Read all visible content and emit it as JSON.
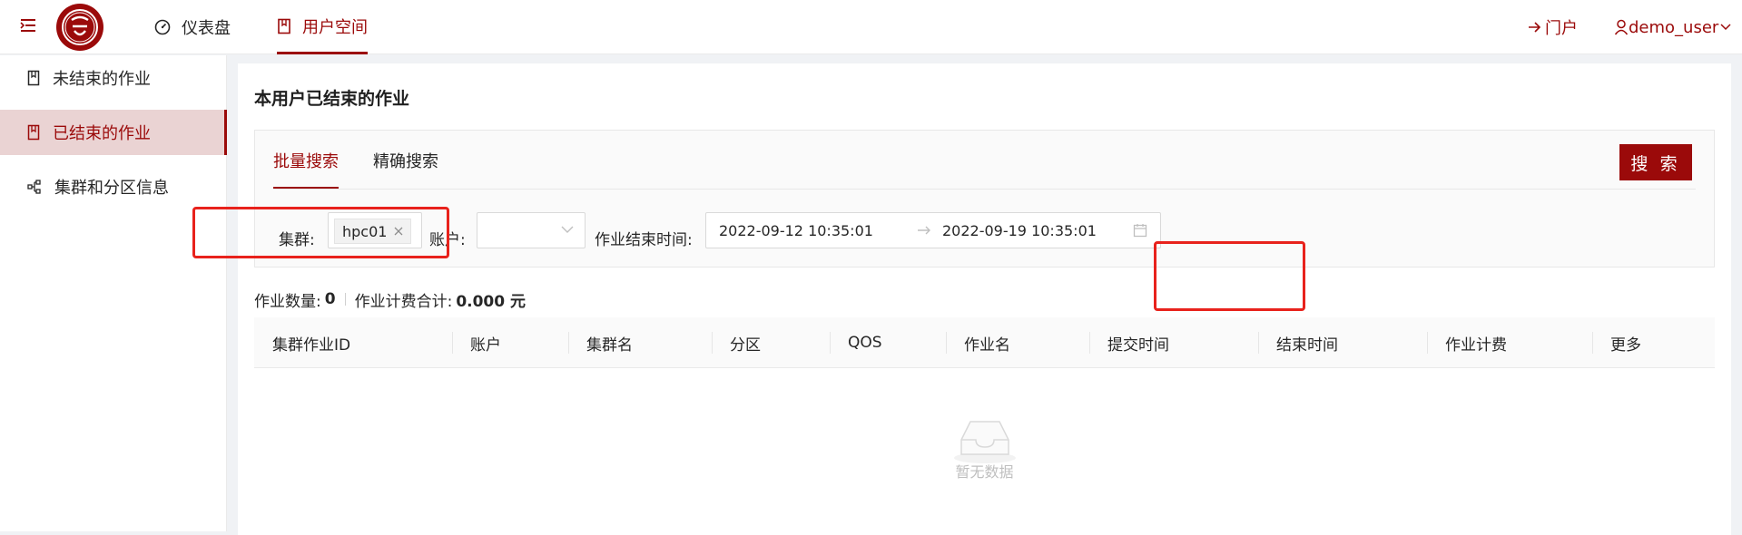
{
  "topbar": {
    "menu_icon": "menu-fold-icon",
    "logo_icon": "university-seal-logo",
    "nav": [
      {
        "label": "仪表盘",
        "icon": "dashboard-icon",
        "active": false
      },
      {
        "label": "用户空间",
        "icon": "book-icon",
        "active": true
      }
    ],
    "portal_label": "门户",
    "portal_icon": "arrow-right-icon",
    "user_label": "demo_user",
    "user_icon": "user-icon",
    "user_chevron": "chevron-down-icon"
  },
  "sidebar": {
    "items": [
      {
        "label": "未结束的作业",
        "icon": "book-icon",
        "active": false
      },
      {
        "label": "已结束的作业",
        "icon": "book-icon",
        "active": true
      },
      {
        "label": "集群和分区信息",
        "icon": "cluster-icon",
        "active": false
      }
    ]
  },
  "main": {
    "title": "本用户已结束的作业",
    "tabs": [
      {
        "label": "批量搜索",
        "active": true
      },
      {
        "label": "精确搜索",
        "active": false
      }
    ],
    "search_button": "搜 索",
    "filters": {
      "cluster_label": "集群:",
      "cluster_tag": "hpc01",
      "account_label": "账户:",
      "account_value": "",
      "end_time_label": "作业结束时间:",
      "start": "2022-09-12 10:35:01",
      "end": "2022-09-19 10:35:01"
    },
    "summary": {
      "count_label": "作业数量:",
      "count_value": "0",
      "fee_label": "作业计费合计:",
      "fee_value": "0.000 元"
    },
    "columns": [
      "集群作业ID",
      "账户",
      "集群名",
      "分区",
      "QOS",
      "作业名",
      "提交时间",
      "结束时间",
      "作业计费",
      "更多"
    ],
    "empty_text": "暂无数据"
  },
  "colors": {
    "brand": "#9b0a0a",
    "highlight": "#e8221c"
  }
}
